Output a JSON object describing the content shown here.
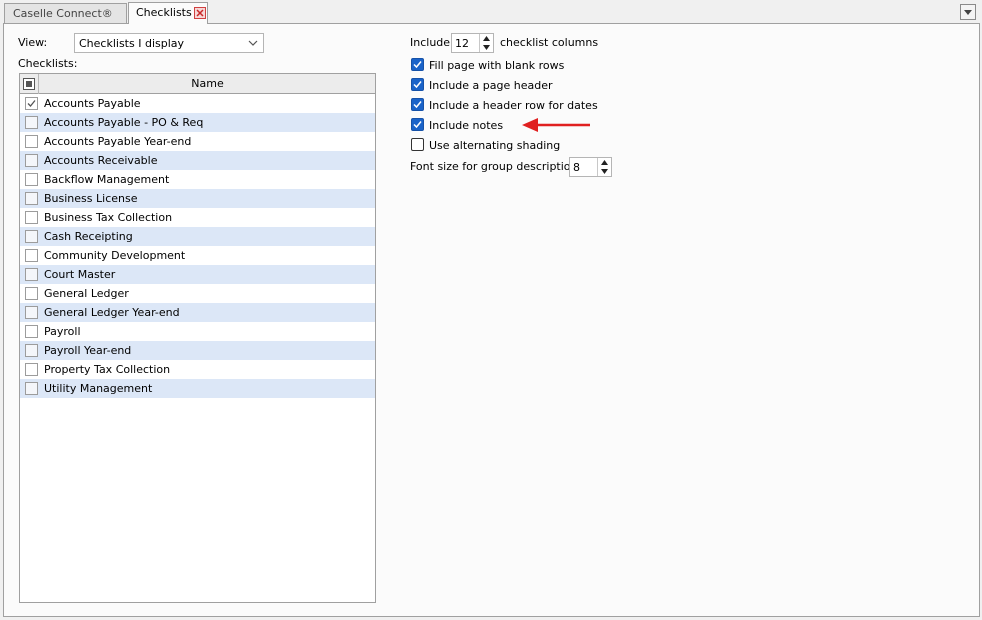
{
  "tabs": [
    {
      "label": "Caselle Connect®",
      "active": false
    },
    {
      "label": "Checklists",
      "active": true
    }
  ],
  "view": {
    "label": "View:",
    "selected": "Checklists I display"
  },
  "checklists": {
    "label": "Checklists:",
    "column_header": "Name",
    "items": [
      {
        "name": "Accounts Payable",
        "checked": true
      },
      {
        "name": "Accounts Payable - PO & Req",
        "checked": false
      },
      {
        "name": "Accounts Payable Year-end",
        "checked": false
      },
      {
        "name": "Accounts Receivable",
        "checked": false
      },
      {
        "name": "Backflow Management",
        "checked": false
      },
      {
        "name": "Business License",
        "checked": false
      },
      {
        "name": "Business Tax Collection",
        "checked": false
      },
      {
        "name": "Cash Receipting",
        "checked": false
      },
      {
        "name": "Community Development",
        "checked": false
      },
      {
        "name": "Court Master",
        "checked": false
      },
      {
        "name": "General Ledger",
        "checked": false
      },
      {
        "name": "General Ledger Year-end",
        "checked": false
      },
      {
        "name": "Payroll",
        "checked": false
      },
      {
        "name": "Payroll Year-end",
        "checked": false
      },
      {
        "name": "Property Tax Collection",
        "checked": false
      },
      {
        "name": "Utility Management",
        "checked": false
      }
    ]
  },
  "options": {
    "include_label": "Include",
    "columns_value": "12",
    "columns_suffix": "checklist columns",
    "fill_blank_rows": {
      "label": "Fill page with blank rows",
      "checked": true
    },
    "page_header": {
      "label": "Include a page header",
      "checked": true
    },
    "header_row_dates": {
      "label": "Include a header row for dates",
      "checked": true
    },
    "include_notes": {
      "label": "Include notes",
      "checked": true
    },
    "alternating_shading": {
      "label": "Use alternating shading",
      "checked": false
    },
    "font_size_label": "Font size for group description:",
    "font_size_value": "8"
  },
  "colors": {
    "accent": "#1a63c9",
    "row_shade": "#dce7f7",
    "annotation_arrow": "#e02020"
  }
}
